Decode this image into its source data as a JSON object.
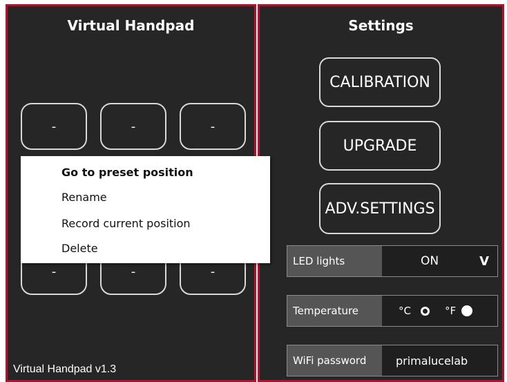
{
  "left": {
    "title": "Virtual Handpad",
    "presets": [
      "-",
      "-",
      "-",
      "-",
      "-",
      "-"
    ],
    "version": "Virtual Handpad v1.3"
  },
  "context_menu": {
    "items": [
      {
        "label": "Go to preset position",
        "bold": true
      },
      {
        "label": "Rename"
      },
      {
        "label": "Record current position"
      },
      {
        "label": "Delete"
      }
    ]
  },
  "right": {
    "title": "Settings",
    "buttons": {
      "calibration": "CALIBRATION",
      "upgrade": "UPGRADE",
      "adv_settings": "ADV.SETTINGS"
    },
    "led": {
      "label": "LED lights",
      "value": "ON",
      "chevron": "V"
    },
    "temperature": {
      "label": "Temperature",
      "celsius": "°C",
      "fahrenheit": "°F",
      "selected": "°F"
    },
    "wifi": {
      "label": "WiFi password",
      "value": "primalucelab"
    }
  },
  "colors": {
    "accent_border": "#b3122c",
    "panel_bg": "#262626"
  }
}
